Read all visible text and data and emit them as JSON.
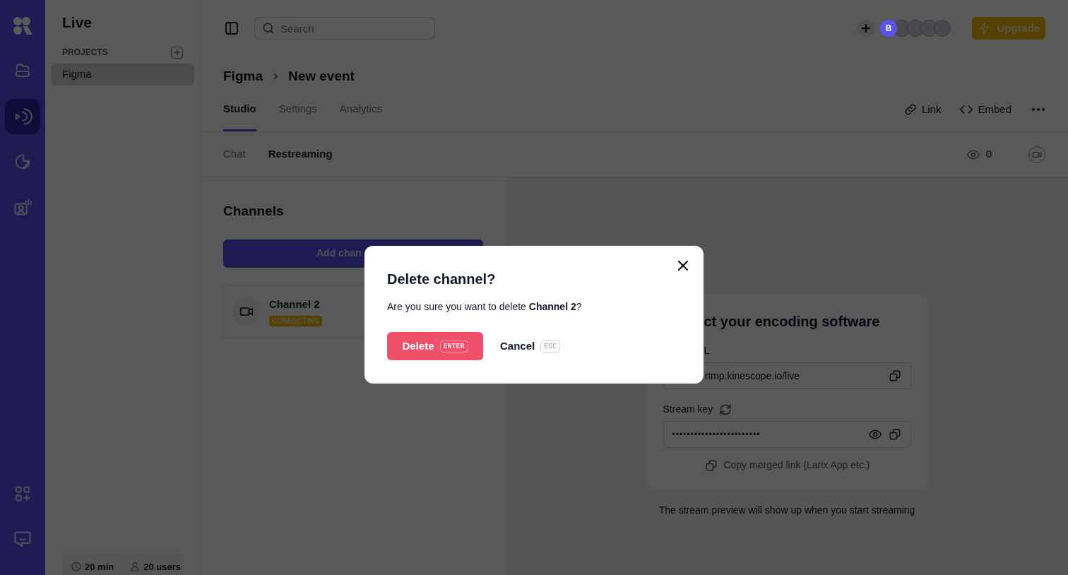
{
  "rail": {
    "items": [
      {
        "kind": "logo",
        "selected": false
      },
      {
        "kind": "folder",
        "selected": false
      },
      {
        "kind": "live",
        "selected": true
      },
      {
        "kind": "analytics",
        "selected": false
      },
      {
        "kind": "people",
        "selected": false
      }
    ],
    "bottom_items": [
      {
        "kind": "apps",
        "selected": false
      },
      {
        "kind": "chat",
        "selected": false
      }
    ]
  },
  "sidebar": {
    "title": "Live",
    "section": "PROJECTS",
    "projects": [
      {
        "label": "Figma",
        "selected": true
      }
    ],
    "footer": [
      {
        "kind": "clock",
        "text": "20 min"
      },
      {
        "kind": "user",
        "text": "20 users"
      }
    ]
  },
  "topbar": {
    "search": {
      "placeholder": "Search"
    },
    "avatars": [
      {
        "kind": "initial",
        "label": "B"
      },
      {
        "kind": "blank"
      },
      {
        "kind": "blank"
      },
      {
        "kind": "blank"
      },
      {
        "kind": "blank"
      }
    ],
    "upgrade": "Upgrade"
  },
  "breadcrumb": [
    "Figma",
    "New event"
  ],
  "tabs": [
    {
      "label": "Studio",
      "selected": true
    },
    {
      "label": "Settings",
      "selected": false
    },
    {
      "label": "Analytics",
      "selected": false
    }
  ],
  "actions": [
    {
      "kind": "link",
      "label": "Link"
    },
    {
      "kind": "embed",
      "label": "Embed"
    }
  ],
  "subtabs": [
    {
      "label": "Chat",
      "selected": false
    },
    {
      "label": "Restreaming",
      "selected": true
    }
  ],
  "viewers": "0",
  "channels": {
    "title": "Channels",
    "add_button": "Add chan",
    "items": [
      {
        "name": "Channel 2",
        "status": "CONNECTING"
      }
    ]
  },
  "encoder": {
    "title": "ct your encoding software",
    "url_label": "L",
    "url": "rtmp.kinescope.io/live",
    "key_label": "Stream key",
    "key": "••••••••••••••••••••••••",
    "copy_merged": "Copy merged link (Larix App etc.)"
  },
  "preview_note": "The stream preview will show up when you start streaming",
  "dialog": {
    "title": "Delete channel?",
    "message": "Are you sure you want to delete **Channel 2**?",
    "confirm": {
      "label": "Delete",
      "key": "ENTER"
    },
    "cancel": {
      "label": "Cancel",
      "key": "ESC"
    }
  }
}
